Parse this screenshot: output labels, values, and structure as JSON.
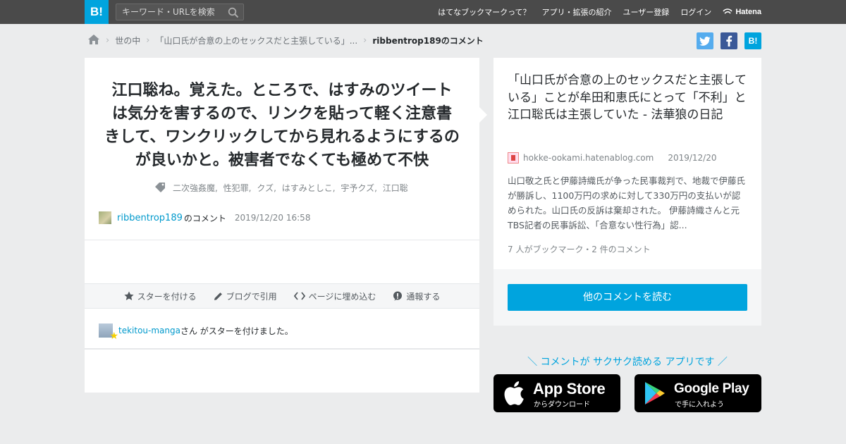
{
  "header": {
    "logo_text": "B!",
    "search_placeholder": "キーワード・URLを検索",
    "nav": [
      "はてなブックマークって？",
      "アプリ・拡張の紹介",
      "ユーザー登録",
      "ログイン"
    ],
    "brand": "Hatena"
  },
  "breadcrumb": {
    "items": [
      "世の中",
      "「山口氏が合意の上のセックスだと主張している」...",
      "ribbentrop189のコメント"
    ]
  },
  "share": {
    "twitter_icon": "twitter-icon",
    "facebook_icon": "facebook-icon",
    "hatena_label": "B!"
  },
  "comment": {
    "text": "江口聡ね。覚えた。ところで、はすみのツイートは気分を害するので、リンクを貼って軽く注意書きして、ワンクリックしてから見れるようにするのが良いかと。被害者でなくても極めて不快",
    "tags": [
      "二次強姦魔,",
      "性犯罪,",
      "クズ,",
      "はすみとしこ,",
      "宇予クズ,",
      "江口聡"
    ],
    "user": "ribbentrop189",
    "user_suffix": "のコメント",
    "datetime": "2019/12/20 16:58"
  },
  "actions": {
    "star": "スターを付ける",
    "quote": "ブログで引用",
    "embed": "ページに埋め込む",
    "report": "通報する"
  },
  "stars": {
    "user": "tekitou-manga",
    "message": "さん がスターを付けました。"
  },
  "entry": {
    "title": "「山口氏が合意の上のセックスだと主張している」ことが牟田和恵氏にとって「不利」と江口聡氏は主張していた - 法華狼の日記",
    "domain": "hokke-ookami.hatenablog.com",
    "date": "2019/12/20",
    "summary": "山口敬之氏と伊藤詩織氏が争った民事裁判で、地裁で伊藤氏が勝訴し、1100万円の求めに対して330万円の支払いが認められた。山口氏の反訴は棄却された。 伊藤詩織さんと元TBS記者の民事訴訟、「合意ない性行為」認...",
    "count": "7 人がブックマーク・2 件のコメント",
    "read_button": "他のコメントを読む"
  },
  "promo": {
    "text": "＼ コメントが サクサク読める アプリです ／",
    "app_store": {
      "big": "App Store",
      "small": "からダウンロード"
    },
    "google_play": {
      "big": "Google Play",
      "small": "で手に入れよう"
    }
  },
  "colors": {
    "accent": "#00a4de",
    "header_bg": "#4a4a4a",
    "page_bg": "#ebeced",
    "link": "#0099cc"
  }
}
